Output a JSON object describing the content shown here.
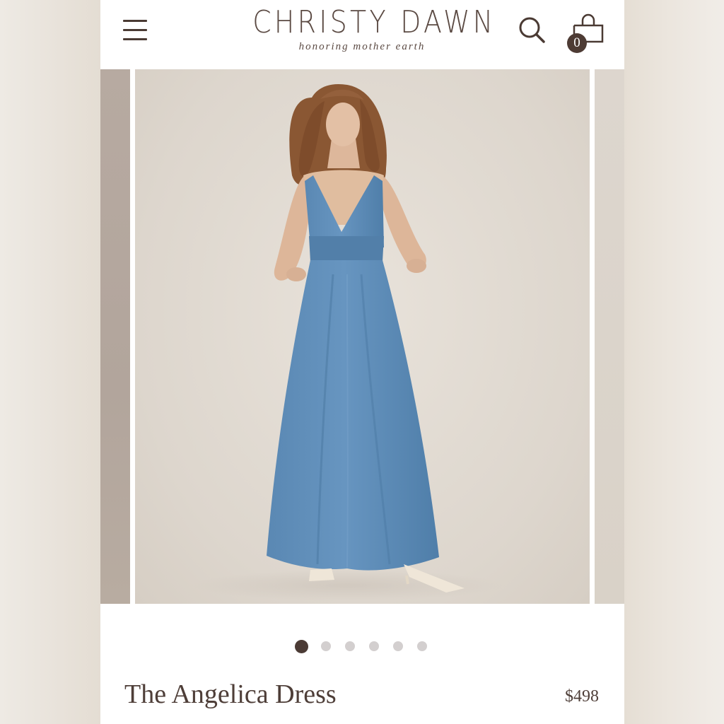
{
  "header": {
    "brand_name": "CHRISTY DAWN",
    "brand_tagline": "honoring mother earth",
    "cart_count": "0",
    "icons": {
      "menu": "hamburger-menu-icon",
      "search": "search-icon",
      "cart": "shopping-bag-icon"
    }
  },
  "gallery": {
    "image_alt": "Model wearing The Angelica Dress in blue",
    "slide_count": 6,
    "active_slide": 1
  },
  "product": {
    "title": "The Angelica Dress",
    "price": "$498"
  },
  "colors": {
    "brand_brown": "#4e3e38",
    "dress_blue": "#5f8fba",
    "dot_inactive": "#d3cfcf",
    "dot_active": "#4b3b35"
  }
}
